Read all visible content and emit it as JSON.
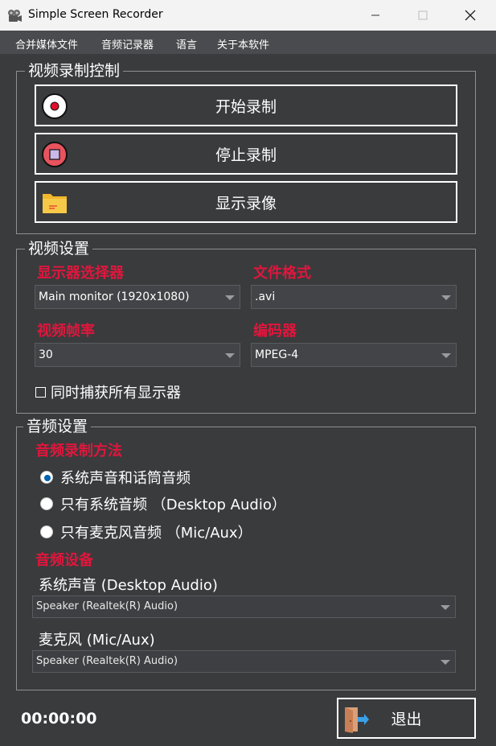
{
  "window": {
    "title": "Simple Screen Recorder"
  },
  "menu": [
    "合并媒体文件",
    "音频记录器",
    "语言",
    "关于本软件"
  ],
  "control": {
    "group_title": "视频录制控制",
    "start_label": "开始录制",
    "stop_label": "停止录制",
    "show_label": "显示录像"
  },
  "video": {
    "group_title": "视频设置",
    "monitor_label": "显示器选择器",
    "monitor_value": "Main monitor (1920x1080)",
    "format_label": "文件格式",
    "format_value": ".avi",
    "fps_label": "视频帧率",
    "fps_value": "30",
    "codec_label": "编码器",
    "codec_value": "MPEG-4",
    "capture_all_label": "同时捕获所有显示器",
    "capture_all_checked": false
  },
  "audio": {
    "group_title": "音频设置",
    "method_label": "音频录制方法",
    "methods": [
      {
        "label": "系统声音和话筒音频",
        "selected": true
      },
      {
        "label": "只有系统音频 （Desktop Audio）",
        "selected": false
      },
      {
        "label": "只有麦克风音频 （Mic/Aux）",
        "selected": false
      }
    ],
    "devices_label": "音频设备",
    "system_label": "系统声音 (Desktop Audio)",
    "system_value": "Speaker (Realtek(R) Audio)",
    "mic_label": "麦克风 (Mic/Aux)",
    "mic_value": "Speaker (Realtek(R) Audio)"
  },
  "footer": {
    "timer": "00:00:00",
    "exit_label": "退出"
  },
  "colors": {
    "background": "#3a3b3d",
    "accent_label": "#e0163c",
    "radio_selected": "#0063b1",
    "titlebar": "#f3f3f3"
  }
}
